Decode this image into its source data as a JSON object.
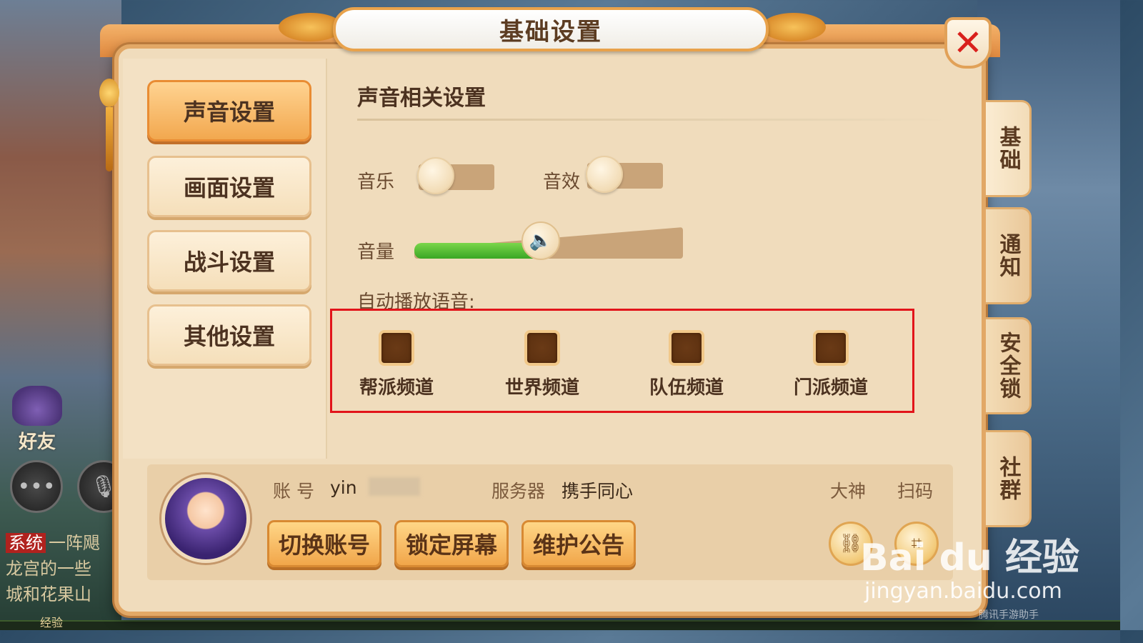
{
  "window": {
    "title": "基础设置"
  },
  "menu": {
    "items": [
      {
        "label": "声音设置",
        "active": true
      },
      {
        "label": "画面设置",
        "active": false
      },
      {
        "label": "战斗设置",
        "active": false
      },
      {
        "label": "其他设置",
        "active": false
      }
    ]
  },
  "side_tabs": [
    {
      "label": "基础",
      "active": true
    },
    {
      "label": "通知",
      "active": false
    },
    {
      "label": "安全锁",
      "active": false
    },
    {
      "label": "社群",
      "active": false
    }
  ],
  "sound": {
    "section_title": "声音相关设置",
    "music_label": "音乐",
    "music_on": false,
    "sfx_label": "音效",
    "sfx_on": false,
    "volume_label": "音量",
    "volume_fraction": 0.47,
    "auto_play_title": "自动播放语音:",
    "channels": [
      {
        "label": "帮派频道",
        "checked": false
      },
      {
        "label": "世界频道",
        "checked": false
      },
      {
        "label": "队伍频道",
        "checked": false
      },
      {
        "label": "门派频道",
        "checked": false
      }
    ]
  },
  "account": {
    "account_label": "账 号",
    "account_value": "yin",
    "server_label": "服务器",
    "server_value": "携手同心",
    "link_great_god": "大神",
    "link_scan": "扫码",
    "buttons": {
      "switch_account": "切换账号",
      "lock_screen": "锁定屏幕",
      "maintenance_notice": "维护公告"
    }
  },
  "hud": {
    "friends_label": "好友",
    "chat_system_tag": "系统",
    "chat_lines": [
      "一阵飓",
      "龙宫的一些",
      "城和花果山"
    ],
    "exp_label": "经验"
  },
  "watermark": {
    "brand": "Bai du 经验",
    "url": "jingyan.baidu.com",
    "small": "腾讯手游助手"
  },
  "colors": {
    "accent_orange": "#f2a84f",
    "highlight_red": "#e2141a",
    "volume_green": "#3aa624",
    "close_red": "#d9201c"
  }
}
